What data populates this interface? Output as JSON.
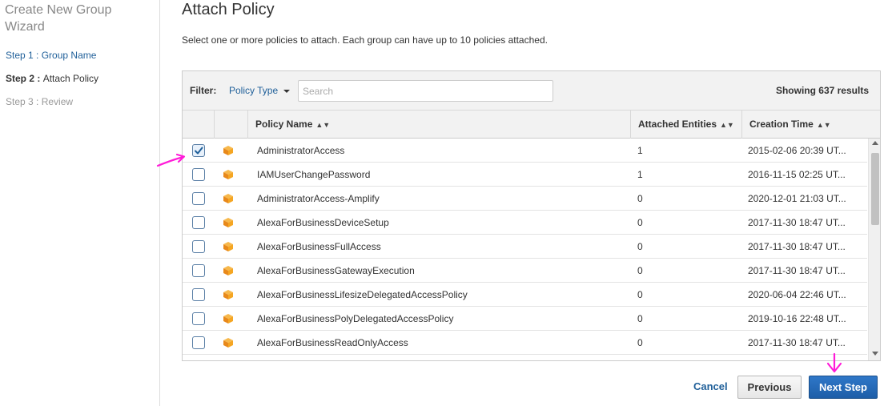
{
  "sidebar": {
    "wizard_title": "Create New Group Wizard",
    "steps": [
      {
        "num": "Step 1",
        "label": "Group Name"
      },
      {
        "num": "Step 2",
        "label": "Attach Policy"
      },
      {
        "num": "Step 3",
        "label": "Review"
      }
    ],
    "separator": " : "
  },
  "main": {
    "title": "Attach Policy",
    "description": "Select one or more policies to attach. Each group can have up to 10 policies attached."
  },
  "filter": {
    "label": "Filter:",
    "policy_type": "Policy Type",
    "search_placeholder": "Search",
    "showing": "Showing 637 results"
  },
  "table": {
    "columns": {
      "name": "Policy Name",
      "entities": "Attached Entities",
      "time": "Creation Time"
    },
    "rows": [
      {
        "checked": true,
        "name": "AdministratorAccess",
        "entities": "1",
        "time": "2015-02-06 20:39 UT..."
      },
      {
        "checked": false,
        "name": "IAMUserChangePassword",
        "entities": "1",
        "time": "2016-11-15 02:25 UT..."
      },
      {
        "checked": false,
        "name": "AdministratorAccess-Amplify",
        "entities": "0",
        "time": "2020-12-01 21:03 UT..."
      },
      {
        "checked": false,
        "name": "AlexaForBusinessDeviceSetup",
        "entities": "0",
        "time": "2017-11-30 18:47 UT..."
      },
      {
        "checked": false,
        "name": "AlexaForBusinessFullAccess",
        "entities": "0",
        "time": "2017-11-30 18:47 UT..."
      },
      {
        "checked": false,
        "name": "AlexaForBusinessGatewayExecution",
        "entities": "0",
        "time": "2017-11-30 18:47 UT..."
      },
      {
        "checked": false,
        "name": "AlexaForBusinessLifesizeDelegatedAccessPolicy",
        "entities": "0",
        "time": "2020-06-04 22:46 UT..."
      },
      {
        "checked": false,
        "name": "AlexaForBusinessPolyDelegatedAccessPolicy",
        "entities": "0",
        "time": "2019-10-16 22:48 UT..."
      },
      {
        "checked": false,
        "name": "AlexaForBusinessReadOnlyAccess",
        "entities": "0",
        "time": "2017-11-30 18:47 UT..."
      }
    ]
  },
  "footer": {
    "cancel": "Cancel",
    "previous": "Previous",
    "next": "Next Step"
  },
  "colors": {
    "link": "#1f5f99",
    "primary_button": "#2168b8",
    "policy_icon": "#f5a623",
    "annotation": "#ff1bd8"
  },
  "icons": {
    "policy": "policy-box-icon",
    "sort": "sort-arrows-icon",
    "dropdown": "caret-down-icon",
    "checkbox": "checkmark-icon"
  }
}
